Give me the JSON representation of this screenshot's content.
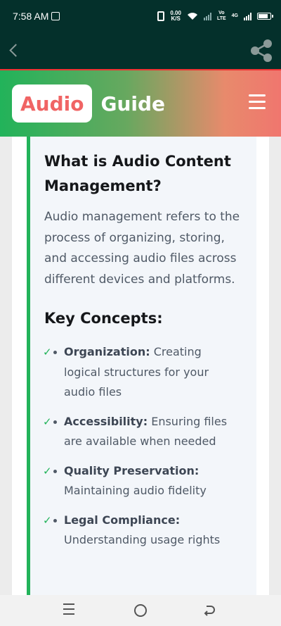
{
  "status_bar": {
    "time": "7:58 AM",
    "speed_value": "0.00",
    "speed_unit": "K/S",
    "volte_label": "Vo",
    "lte_label": "LTE",
    "network": "4G"
  },
  "app_bar": {
    "back_icon": "chevron-left-icon",
    "share_icon": "share-icon"
  },
  "header": {
    "logo_highlight": "Audio",
    "logo_text": "Guide",
    "menu_icon": "hamburger-icon",
    "colors": {
      "green": "#22b35a",
      "coral": "#f0766e"
    }
  },
  "article": {
    "title": "What is Audio Content Management?",
    "description": "Audio management refers to the process of organizing, storing, and accessing audio files across different devices and platforms.",
    "key_title": "Key Concepts:",
    "concepts": [
      {
        "label": "Organization:",
        "text": " Creating logical structures for your audio files"
      },
      {
        "label": "Accessibility:",
        "text": " Ensuring files are available when needed"
      },
      {
        "label": "Quality Preservation:",
        "text": " Maintaining audio fidelity"
      },
      {
        "label": "Legal Compliance:",
        "text": " Understanding usage rights"
      }
    ],
    "check_glyph": "✓"
  },
  "nav_bar": {
    "icons": [
      "recent-apps-icon",
      "home-icon",
      "back-icon"
    ]
  }
}
